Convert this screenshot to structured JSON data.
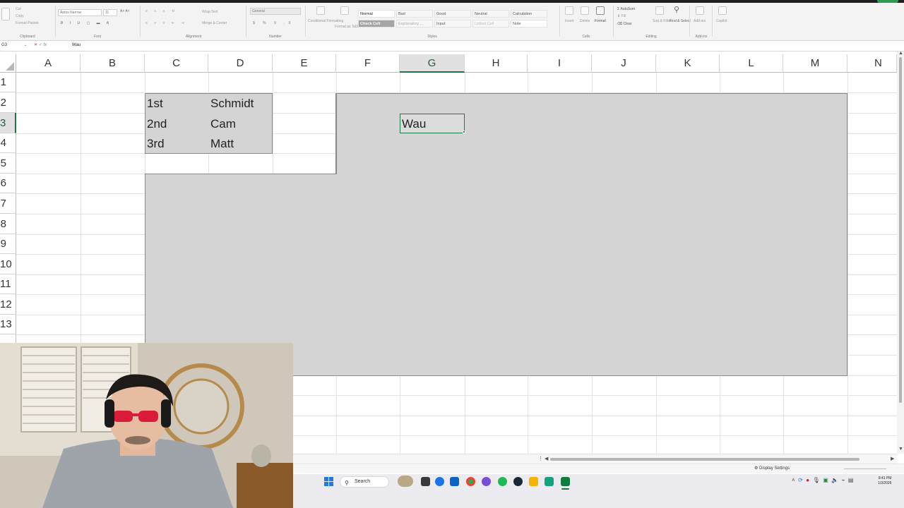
{
  "ribbon": {
    "clipboard": {
      "cut": "Cut",
      "copy": "Copy",
      "format_painter": "Format Painter",
      "label": "Clipboard"
    },
    "font": {
      "name": "Aptos Narrow",
      "size": "11",
      "label": "Font"
    },
    "alignment": {
      "wrap_text": "Wrap Text",
      "merge_center": "Merge & Center",
      "label": "Alignment"
    },
    "number": {
      "format": "General",
      "label": "Number"
    },
    "styles": {
      "conditional": "Conditional Formatting",
      "format_as_table": "Format as Table",
      "label": "Styles",
      "gallery": [
        "Normal",
        "Bad",
        "Good",
        "Neutral",
        "Calculation",
        "Check Cell",
        "Explanatory ...",
        "Input",
        "Linked Cell",
        "Note"
      ]
    },
    "cells": {
      "insert": "Insert",
      "delete": "Delete",
      "format": "Format",
      "label": "Cells"
    },
    "editing": {
      "autosum": "AutoSum",
      "fill": "Fill",
      "clear": "Clear",
      "sort_filter": "Sort & Filter",
      "find_select": "Find & Select",
      "label": "Editing"
    },
    "addins": {
      "addins": "Add-ins",
      "label": "Add-ins"
    },
    "copilot": "Copilot"
  },
  "formula_bar": {
    "name_box": "G3",
    "fx": "fx",
    "value": "Wau"
  },
  "grid": {
    "columns": [
      "A",
      "B",
      "C",
      "D",
      "E",
      "F",
      "G",
      "H",
      "I",
      "J",
      "K",
      "L",
      "M",
      "N"
    ],
    "rows": [
      "1",
      "2",
      "3",
      "4",
      "5",
      "6",
      "7",
      "8",
      "9",
      "10",
      "11",
      "12",
      "13"
    ],
    "selected_column": "G",
    "selected_row": "3",
    "cells": {
      "C2": "1st",
      "D2": "Schmidt",
      "C3": "2nd",
      "D3": "Cam",
      "C4": "3rd",
      "D4": "Matt",
      "G3": "Wau"
    }
  },
  "statusbar": {
    "display_settings": "Display Settings"
  },
  "taskbar": {
    "search": "Search",
    "clock_time": "8:41 PM",
    "clock_date": "1/3/2026"
  },
  "colors": {
    "excel_green": "#217346",
    "shade_gray": "#d4d4d4",
    "gridline": "#e2e2e2"
  }
}
